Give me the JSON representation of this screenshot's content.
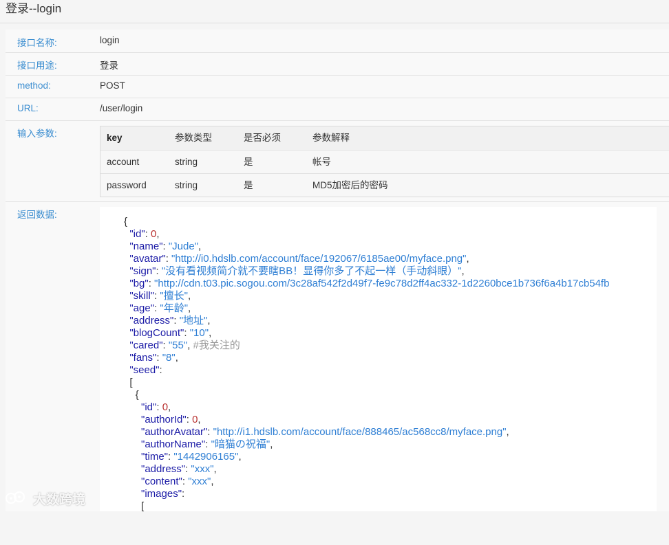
{
  "page": {
    "title": "登录--login"
  },
  "fields": {
    "name": {
      "label": "接口名称:",
      "value": "login"
    },
    "purpose": {
      "label": "接口用途:",
      "value": "登录"
    },
    "method": {
      "label": "method:",
      "value": "POST"
    },
    "url": {
      "label": "URL:",
      "value": "/user/login"
    }
  },
  "params": {
    "label": "输入参数:",
    "headers": [
      "key",
      "参数类型",
      "是否必须",
      "参数解释"
    ],
    "rows": [
      [
        "account",
        "string",
        "是",
        "帐号"
      ],
      [
        "password",
        "string",
        "是",
        "MD5加密后的密码"
      ]
    ]
  },
  "response": {
    "label": "返回数据:",
    "lines": [
      [
        [
          "p",
          "{"
        ]
      ],
      [
        [
          "p",
          "  "
        ],
        [
          "k",
          "\"id\""
        ],
        [
          "p",
          ": "
        ],
        [
          "n",
          "0"
        ],
        [
          "p",
          ","
        ]
      ],
      [
        [
          "p",
          "  "
        ],
        [
          "k",
          "\"name\""
        ],
        [
          "p",
          ": "
        ],
        [
          "s",
          "\"Jude\""
        ],
        [
          "p",
          ","
        ]
      ],
      [
        [
          "p",
          "  "
        ],
        [
          "k",
          "\"avatar\""
        ],
        [
          "p",
          ": "
        ],
        [
          "s",
          "\"http://i0.hdslb.com/account/face/192067/6185ae00/myface.png\""
        ],
        [
          "p",
          ","
        ]
      ],
      [
        [
          "p",
          "  "
        ],
        [
          "k",
          "\"sign\""
        ],
        [
          "p",
          ": "
        ],
        [
          "s",
          "\"没有看视频简介就不要瞎BB！显得你多了不起一样（手动斜眼）\""
        ],
        [
          "p",
          ","
        ]
      ],
      [
        [
          "p",
          "  "
        ],
        [
          "k",
          "\"bg\""
        ],
        [
          "p",
          ": "
        ],
        [
          "s",
          "\"http://cdn.t03.pic.sogou.com/3c28af542f2d49f7-fe9c78d2ff4ac332-1d2260bce1b736f6a4b17cb54fb"
        ]
      ],
      [
        [
          "p",
          "  "
        ],
        [
          "k",
          "\"skill\""
        ],
        [
          "p",
          ": "
        ],
        [
          "s",
          "\"擅长\""
        ],
        [
          "p",
          ","
        ]
      ],
      [
        [
          "p",
          "  "
        ],
        [
          "k",
          "\"age\""
        ],
        [
          "p",
          ": "
        ],
        [
          "s",
          "\"年龄\""
        ],
        [
          "p",
          ","
        ]
      ],
      [
        [
          "p",
          "  "
        ],
        [
          "k",
          "\"address\""
        ],
        [
          "p",
          ": "
        ],
        [
          "s",
          "\"地址\""
        ],
        [
          "p",
          ","
        ]
      ],
      [
        [
          "p",
          "  "
        ],
        [
          "k",
          "\"blogCount\""
        ],
        [
          "p",
          ": "
        ],
        [
          "s",
          "\"10\""
        ],
        [
          "p",
          ","
        ]
      ],
      [
        [
          "p",
          "  "
        ],
        [
          "k",
          "\"cared\""
        ],
        [
          "p",
          ": "
        ],
        [
          "s",
          "\"55\""
        ],
        [
          "p",
          ", "
        ],
        [
          "c",
          "#我关注的"
        ]
      ],
      [
        [
          "p",
          "  "
        ],
        [
          "k",
          "\"fans\""
        ],
        [
          "p",
          ": "
        ],
        [
          "s",
          "\"8\""
        ],
        [
          "p",
          ","
        ]
      ],
      [
        [
          "p",
          "  "
        ],
        [
          "k",
          "\"seed\""
        ],
        [
          "p",
          ":"
        ]
      ],
      [
        [
          "p",
          "  ["
        ]
      ],
      [
        [
          "p",
          "    {"
        ]
      ],
      [
        [
          "p",
          "      "
        ],
        [
          "k",
          "\"id\""
        ],
        [
          "p",
          ": "
        ],
        [
          "n",
          "0"
        ],
        [
          "p",
          ","
        ]
      ],
      [
        [
          "p",
          "      "
        ],
        [
          "k",
          "\"authorId\""
        ],
        [
          "p",
          ": "
        ],
        [
          "n",
          "0"
        ],
        [
          "p",
          ","
        ]
      ],
      [
        [
          "p",
          "      "
        ],
        [
          "k",
          "\"authorAvatar\""
        ],
        [
          "p",
          ": "
        ],
        [
          "s",
          "\"http://i1.hdslb.com/account/face/888465/ac568cc8/myface.png\""
        ],
        [
          "p",
          ","
        ]
      ],
      [
        [
          "p",
          "      "
        ],
        [
          "k",
          "\"authorName\""
        ],
        [
          "p",
          ": "
        ],
        [
          "s",
          "\"暗猫の祝福\""
        ],
        [
          "p",
          ","
        ]
      ],
      [
        [
          "p",
          "      "
        ],
        [
          "k",
          "\"time\""
        ],
        [
          "p",
          ": "
        ],
        [
          "s",
          "\"1442906165\""
        ],
        [
          "p",
          ","
        ]
      ],
      [
        [
          "p",
          "      "
        ],
        [
          "k",
          "\"address\""
        ],
        [
          "p",
          ": "
        ],
        [
          "s",
          "\"xxx\""
        ],
        [
          "p",
          ","
        ]
      ],
      [
        [
          "p",
          "      "
        ],
        [
          "k",
          "\"content\""
        ],
        [
          "p",
          ": "
        ],
        [
          "s",
          "\"xxx\""
        ],
        [
          "p",
          ","
        ]
      ],
      [
        [
          "p",
          "      "
        ],
        [
          "k",
          "\"images\""
        ],
        [
          "p",
          ":"
        ]
      ],
      [
        [
          "p",
          "      ["
        ]
      ]
    ]
  },
  "watermark": {
    "text": "大数跨境",
    "icon": "logo-icon"
  },
  "colors": {
    "label": "#3a8dd0",
    "key": "#1a1aa6",
    "string": "#2f7fd4",
    "number": "#b8312f",
    "comment": "#999999"
  }
}
